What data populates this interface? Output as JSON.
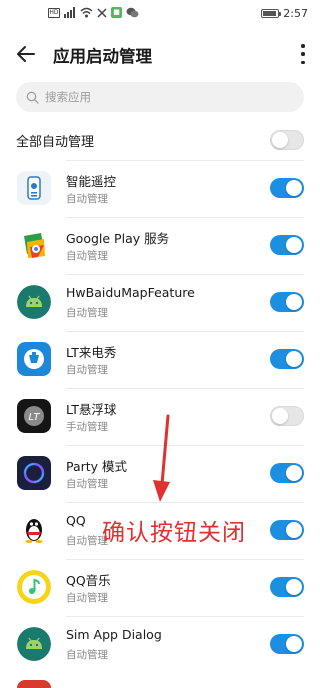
{
  "status_bar": {
    "time": "2:57",
    "icons": [
      "hd-icon",
      "signal-icon",
      "wifi-icon",
      "x-icon",
      "app-badge-icon",
      "wechat-icon"
    ],
    "battery_level": 0.9
  },
  "header": {
    "title": "应用启动管理",
    "back_icon": "arrow-left-icon",
    "more_icon": "more-vertical-icon"
  },
  "search": {
    "placeholder": "搜索应用"
  },
  "master": {
    "label": "全部自动管理",
    "enabled": false
  },
  "apps": [
    {
      "name": "智能遥控",
      "mode": "自动管理",
      "enabled": true,
      "icon": "remote-control-icon"
    },
    {
      "name": "Google Play 服务",
      "mode": "自动管理",
      "enabled": true,
      "icon": "google-play-services-icon"
    },
    {
      "name": "HwBaiduMapFeature",
      "mode": "自动管理",
      "enabled": true,
      "icon": "android-icon"
    },
    {
      "name": "LT来电秀",
      "mode": "自动管理",
      "enabled": true,
      "icon": "lt-caller-show-icon"
    },
    {
      "name": "LT悬浮球",
      "mode": "手动管理",
      "enabled": false,
      "icon": "lt-float-ball-icon"
    },
    {
      "name": "Party 模式",
      "mode": "自动管理",
      "enabled": true,
      "icon": "party-mode-icon"
    },
    {
      "name": "QQ",
      "mode": "自动管理",
      "enabled": true,
      "icon": "qq-penguin-icon"
    },
    {
      "name": "QQ音乐",
      "mode": "自动管理",
      "enabled": true,
      "icon": "qq-music-icon"
    },
    {
      "name": "Sim App Dialog",
      "mode": "自动管理",
      "enabled": true,
      "icon": "android-icon"
    }
  ],
  "annotation": {
    "text": "确认按钮关闭"
  },
  "colors": {
    "toggle_on": "#1d8fe0",
    "toggle_off": "#e6e6e6",
    "annotation": "#e03030"
  }
}
